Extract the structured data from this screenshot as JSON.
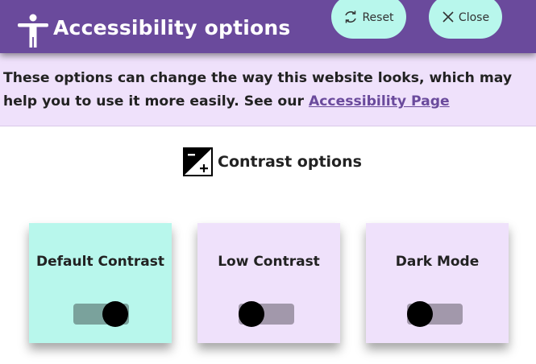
{
  "header": {
    "title": "Accessibility options",
    "reset_label": "Reset",
    "close_label": "Close",
    "bg_color": "#6a4a9c",
    "button_color": "#b8f7ec"
  },
  "info": {
    "text": "These options can change the way this website looks, which may help you to use it more easily. See our",
    "link_label": "Accessibility Page",
    "bg_color": "#efe1fb"
  },
  "contrast": {
    "title": "Contrast options",
    "icon": "contrast-icon",
    "options": [
      {
        "label": "Default Contrast",
        "on": true,
        "bg_color": "#b8f7ec"
      },
      {
        "label": "Low Contrast",
        "on": false,
        "bg_color": "#efe1fb"
      },
      {
        "label": "Dark Mode",
        "on": false,
        "bg_color": "#efe1fb"
      }
    ]
  }
}
